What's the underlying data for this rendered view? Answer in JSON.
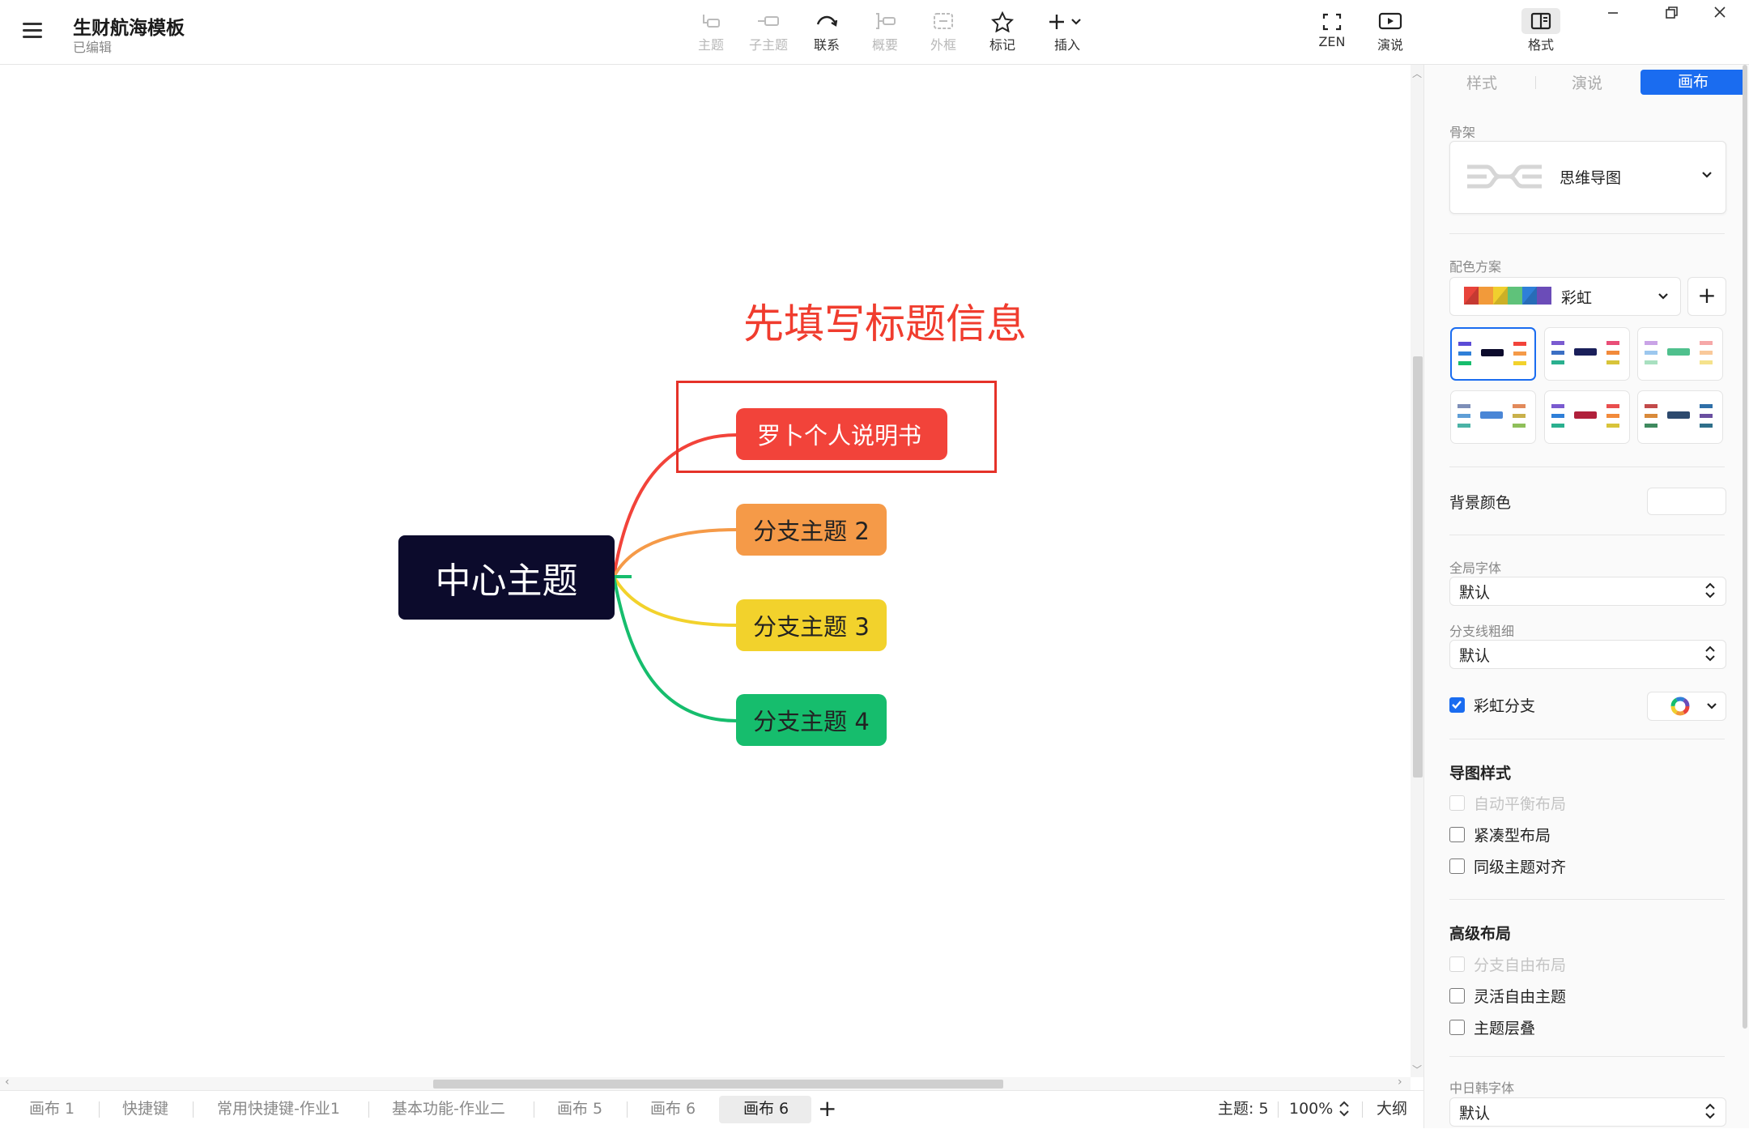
{
  "header": {
    "title": "生财航海模板",
    "status": "已编辑"
  },
  "toolbar": {
    "items": [
      {
        "label": "主题",
        "icon": "topic-icon",
        "enabled": false
      },
      {
        "label": "子主题",
        "icon": "subtopic-icon",
        "enabled": false
      },
      {
        "label": "联系",
        "icon": "relationship-icon",
        "enabled": true
      },
      {
        "label": "概要",
        "icon": "summary-icon",
        "enabled": false
      },
      {
        "label": "外框",
        "icon": "boundary-icon",
        "enabled": false
      },
      {
        "label": "标记",
        "icon": "star-icon",
        "enabled": true
      },
      {
        "label": "插入",
        "icon": "plus-icon",
        "enabled": true
      }
    ],
    "zen": "ZEN",
    "present": "演说",
    "format": "格式"
  },
  "canvas": {
    "hint": "先填写标题信息",
    "central_topic": "中心主题",
    "branches": [
      {
        "label": "罗卜个人说明书",
        "color": "#f2433a"
      },
      {
        "label": "分支主题 2",
        "color": "#f59a48"
      },
      {
        "label": "分支主题 3",
        "color": "#f2d22c"
      },
      {
        "label": "分支主题 4",
        "color": "#16bd6d"
      }
    ],
    "central_color": "#0c0b2c",
    "highlight_color": "#e53229"
  },
  "sheets": {
    "tabs": [
      "画布 1",
      "快捷键",
      "常用快捷键-作业1",
      "基本功能-作业二",
      "画布 5",
      "画布 6",
      "画布 6"
    ],
    "active_index": 6,
    "add": "+"
  },
  "status_bar": {
    "topic_count": "主题: 5",
    "zoom": "100%",
    "outline": "大纲"
  },
  "panel": {
    "tabs": [
      "样式",
      "演说",
      "画布"
    ],
    "active_tab": 2,
    "skeleton_label": "骨架",
    "skeleton_value": "思维导图",
    "color_scheme_label": "配色方案",
    "color_scheme_value": "彩虹",
    "add_button": "+",
    "bg_color_label": "背景颜色",
    "global_font_label": "全局字体",
    "global_font_value": "默认",
    "branch_width_label": "分支线粗细",
    "branch_width_value": "默认",
    "rainbow_branch_label": "彩虹分支",
    "rainbow_branch_checked": true,
    "map_style_title": "导图样式",
    "map_style_options": [
      {
        "label": "自动平衡布局",
        "enabled": false,
        "checked": false
      },
      {
        "label": "紧凑型布局",
        "enabled": true,
        "checked": false
      },
      {
        "label": "同级主题对齐",
        "enabled": true,
        "checked": false
      }
    ],
    "advanced_title": "高级布局",
    "advanced_options": [
      {
        "label": "分支自由布局",
        "enabled": false,
        "checked": false
      },
      {
        "label": "灵活自由主题",
        "enabled": true,
        "checked": false
      },
      {
        "label": "主题层叠",
        "enabled": true,
        "checked": false
      }
    ],
    "cjk_font_label": "中日韩字体",
    "cjk_font_value": "默认",
    "accent_color": "#1a6cf0"
  }
}
